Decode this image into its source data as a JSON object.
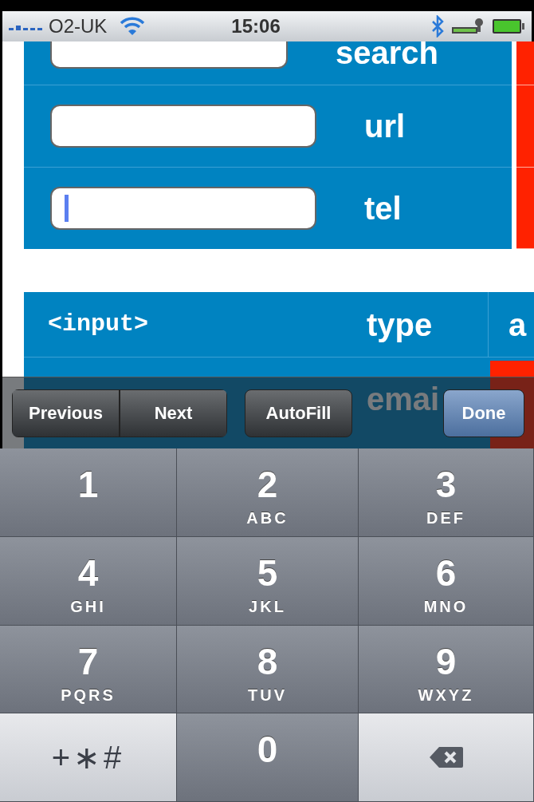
{
  "status_bar": {
    "carrier": "O2-UK",
    "time": "15:06"
  },
  "form_rows": [
    {
      "label": "search",
      "focused": false
    },
    {
      "label": "url",
      "focused": false
    },
    {
      "label": "tel",
      "focused": true
    }
  ],
  "table": {
    "columns": [
      "<input>",
      "type",
      "a"
    ],
    "row_text": "emai"
  },
  "toolbar": {
    "buttons": [
      {
        "label": "Previous",
        "kind": "segment"
      },
      {
        "label": "Next",
        "kind": "segment"
      },
      {
        "label": "AutoFill",
        "kind": "plain"
      },
      {
        "label": "Done",
        "kind": "primary"
      }
    ]
  },
  "keypad": [
    {
      "kind": "digit",
      "digit": "1"
    },
    {
      "kind": "digit",
      "digit": "2",
      "letters": "ABC"
    },
    {
      "kind": "digit",
      "digit": "3",
      "letters": "DEF"
    },
    {
      "kind": "digit",
      "digit": "4",
      "letters": "GHI"
    },
    {
      "kind": "digit",
      "digit": "5",
      "letters": "JKL"
    },
    {
      "kind": "digit",
      "digit": "6",
      "letters": "MNO"
    },
    {
      "kind": "digit",
      "digit": "7",
      "letters": "PQRS"
    },
    {
      "kind": "digit",
      "digit": "8",
      "letters": "TUV"
    },
    {
      "kind": "digit",
      "digit": "9",
      "letters": "WXYZ"
    },
    {
      "kind": "symbols",
      "digit": "+∗#"
    },
    {
      "kind": "digit",
      "digit": "0"
    },
    {
      "kind": "delete"
    }
  ]
}
